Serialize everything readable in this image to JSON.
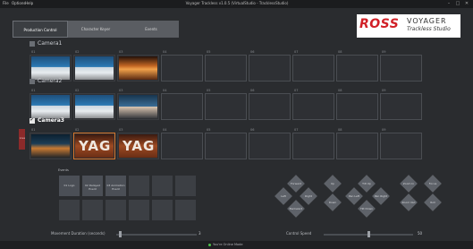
{
  "window": {
    "title": "Voyager Trackless v1.0.5 (VirtualStudio - TracklessStudio)",
    "menu": [
      "File",
      "Options",
      "Help"
    ]
  },
  "tabs": [
    {
      "label": "Production Control",
      "active": true
    },
    {
      "label": "Character Keyer",
      "active": false
    },
    {
      "label": "Events",
      "active": false
    }
  ],
  "logo": {
    "brand": "ROSS",
    "product": "VOYAGER",
    "subtitle": "Trackless Studio",
    "brand_color": "#d12027"
  },
  "cameras": [
    {
      "name": "Camera1",
      "checked": false,
      "bold": false,
      "shots": [
        {
          "label": "01",
          "thumb": "anchor-desk"
        },
        {
          "label": "02",
          "thumb": "anchor-desk"
        },
        {
          "label": "03",
          "thumb": "orange-set"
        },
        {
          "label": "04",
          "thumb": ""
        },
        {
          "label": "05",
          "thumb": ""
        },
        {
          "label": "06",
          "thumb": ""
        },
        {
          "label": "07",
          "thumb": ""
        },
        {
          "label": "08",
          "thumb": ""
        },
        {
          "label": "09",
          "thumb": ""
        }
      ]
    },
    {
      "name": "Camera2",
      "checked": false,
      "bold": false,
      "shots": [
        {
          "label": "01",
          "thumb": "anchor-desk"
        },
        {
          "label": "02",
          "thumb": "anchor-desk"
        },
        {
          "label": "03",
          "thumb": "anchor-closeup"
        },
        {
          "label": "04",
          "thumb": ""
        },
        {
          "label": "05",
          "thumb": ""
        },
        {
          "label": "06",
          "thumb": ""
        },
        {
          "label": "07",
          "thumb": ""
        },
        {
          "label": "08",
          "thumb": ""
        },
        {
          "label": "09",
          "thumb": ""
        }
      ]
    },
    {
      "name": "Camera3",
      "checked": true,
      "bold": true,
      "indicator_text": "Live",
      "shots": [
        {
          "label": "01",
          "thumb": "wide-set"
        },
        {
          "label": "02",
          "thumb": "yag-sign",
          "active": true
        },
        {
          "label": "03",
          "thumb": "yag-sign"
        },
        {
          "label": "04",
          "thumb": ""
        },
        {
          "label": "05",
          "thumb": ""
        },
        {
          "label": "06",
          "thumb": ""
        },
        {
          "label": "07",
          "thumb": ""
        },
        {
          "label": "08",
          "thumb": ""
        },
        {
          "label": "09",
          "thumb": ""
        }
      ]
    }
  ],
  "events": {
    "label": "Events",
    "cells": [
      "01 Logo",
      "02 Delayed Event",
      "03 Animation Event",
      "",
      "",
      "",
      "",
      "",
      "",
      "",
      "",
      ""
    ]
  },
  "pad": {
    "left_cluster": [
      "Forward",
      "Left",
      "Right",
      "Backward"
    ],
    "mid_cluster": [
      "Up",
      "Down"
    ],
    "turn_cluster": [
      "Tilt Up",
      "Pan Left",
      "Pan Right",
      "Tilt Down"
    ],
    "zoom_cluster": [
      "Zoom In",
      "Zoom Out"
    ],
    "focus_cluster": [
      "Focus",
      "Roll"
    ]
  },
  "sliders": {
    "duration": {
      "label": "Movement Duration (seconds)",
      "value": "3",
      "level": 0.04
    },
    "speed": {
      "label": "Control Speed",
      "value": "50",
      "level": 0.5
    }
  },
  "status": {
    "text": "You're Online Mode",
    "color": "#4cc24a"
  }
}
